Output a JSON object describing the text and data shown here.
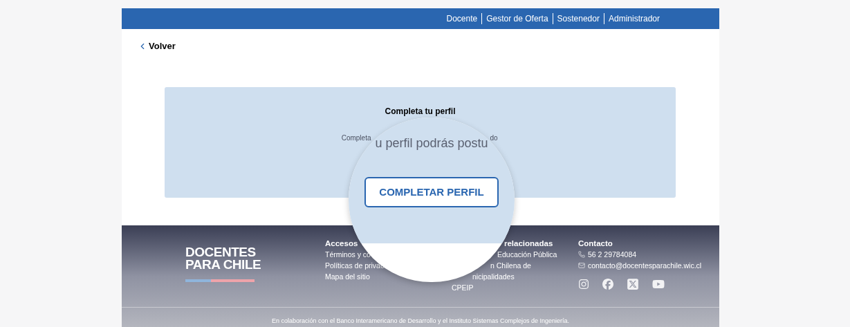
{
  "top_nav": [
    "Docente",
    "Gestor de Oferta",
    "Sostenedor",
    "Administrador"
  ],
  "back_link": "Volver",
  "card": {
    "title": "Completa tu perfil",
    "text_left": "Completa",
    "text_right": "do"
  },
  "magnifier": {
    "text": "u perfil podrás postu",
    "button": "COMPLETAR PERFIL"
  },
  "footer": {
    "logo": [
      "DOCENTES",
      "PARA CHILE"
    ],
    "columns": [
      {
        "title": "Accesos",
        "items": [
          "Términos y co",
          "Políticas de privac",
          "Mapa del sitio"
        ]
      },
      {
        "title": "relacionadas",
        "items": [
          "Educación Pública",
          "n Chilena de",
          "nicipalidades",
          "CPEIP"
        ]
      }
    ],
    "contact": {
      "title": "Contacto",
      "phone": "56 2 29784084",
      "email": "contacto@docentesparachile.wic.cl"
    },
    "credit": "En colaboración con el Banco Interamericano de Desarrollo y el Instituto Sistemas Complejos de Ingeniería."
  }
}
